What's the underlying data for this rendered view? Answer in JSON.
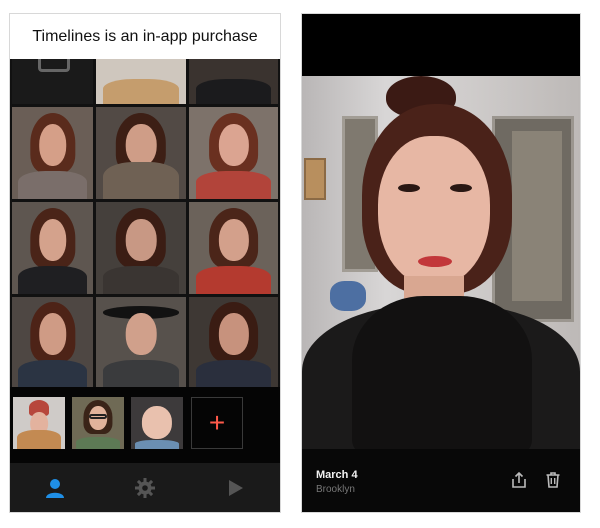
{
  "left_screen": {
    "banner_text": "Timelines is an in-app purchase",
    "add_button_label": "+",
    "tabs": [
      {
        "icon": "person-icon",
        "active": true
      },
      {
        "icon": "gear-icon",
        "active": false
      },
      {
        "icon": "play-icon",
        "active": false
      }
    ]
  },
  "right_screen": {
    "date": "March 4",
    "location": "Brooklyn",
    "actions": [
      "share-icon",
      "trash-icon"
    ]
  },
  "colors": {
    "accent_blue": "#1f8fe6",
    "add_red": "#ff5a4a",
    "tab_inactive": "#555555"
  }
}
